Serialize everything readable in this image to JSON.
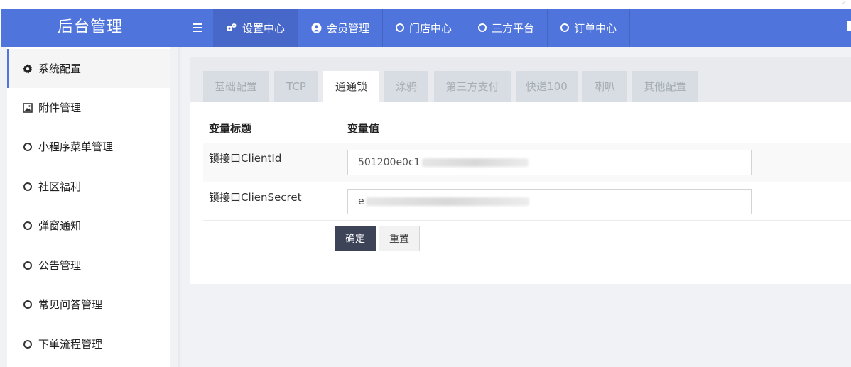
{
  "app": {
    "title": "后台管理"
  },
  "colors": {
    "accent": "#4f74dc",
    "primary_button": "#3e4458"
  },
  "topnav": [
    {
      "label": "设置中心",
      "icon": "gears-icon",
      "active": true
    },
    {
      "label": "会员管理",
      "icon": "user-circle-icon",
      "active": false
    },
    {
      "label": "门店中心",
      "icon": "circle-icon",
      "active": false
    },
    {
      "label": "三方平台",
      "icon": "circle-icon",
      "active": false
    },
    {
      "label": "订单中心",
      "icon": "circle-icon",
      "active": false
    }
  ],
  "sidebar": {
    "items": [
      {
        "label": "系统配置",
        "icon": "gear-icon",
        "active": true
      },
      {
        "label": "附件管理",
        "icon": "image-icon",
        "active": false
      },
      {
        "label": "小程序菜单管理",
        "icon": "circle-icon",
        "active": false
      },
      {
        "label": "社区福利",
        "icon": "circle-icon",
        "active": false
      },
      {
        "label": "弹窗通知",
        "icon": "circle-icon",
        "active": false
      },
      {
        "label": "公告管理",
        "icon": "circle-icon",
        "active": false
      },
      {
        "label": "常见问答管理",
        "icon": "circle-icon",
        "active": false
      },
      {
        "label": "下单流程管理",
        "icon": "circle-icon",
        "active": false
      }
    ]
  },
  "tabs": [
    {
      "label": "基础配置",
      "active": false
    },
    {
      "label": "TCP",
      "active": false
    },
    {
      "label": "通通锁",
      "active": true
    },
    {
      "label": "涂鸦",
      "active": false
    },
    {
      "label": "第三方支付",
      "active": false
    },
    {
      "label": "快递100",
      "active": false
    },
    {
      "label": "喇叭",
      "active": false
    },
    {
      "label": "其他配置",
      "active": false
    }
  ],
  "form": {
    "header_title": "变量标题",
    "header_value": "变量值",
    "rows": [
      {
        "label": "锁接口ClientId",
        "value": "501200e0c1"
      },
      {
        "label": "锁接口ClienSecret",
        "value": "e"
      }
    ],
    "submit_label": "确定",
    "reset_label": "重置"
  }
}
